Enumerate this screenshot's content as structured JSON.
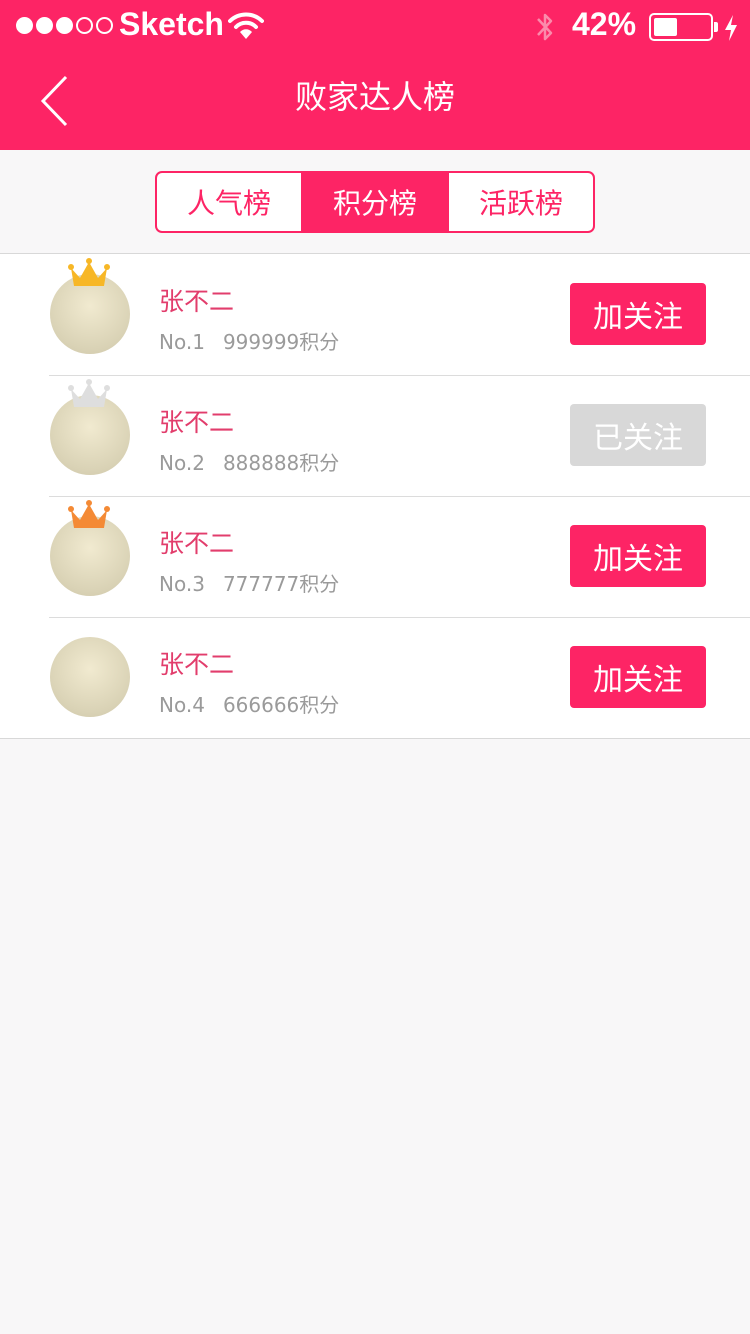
{
  "status_bar": {
    "carrier": "Sketch",
    "battery_percent_text": "42%",
    "battery_level": 0.42
  },
  "nav": {
    "title": "败家达人榜"
  },
  "tabs": [
    {
      "label": "人气榜",
      "active": false
    },
    {
      "label": "积分榜",
      "active": true
    },
    {
      "label": "活跃榜",
      "active": false
    }
  ],
  "rankings": [
    {
      "name": "张不二",
      "rank": "No.1",
      "points": "999999积分",
      "button": "加关注",
      "followed": false,
      "crown_color": "#f7b726"
    },
    {
      "name": "张不二",
      "rank": "No.2",
      "points": "888888积分",
      "button": "已关注",
      "followed": true,
      "crown_color": "#dedede"
    },
    {
      "name": "张不二",
      "rank": "No.3",
      "points": "777777积分",
      "button": "加关注",
      "followed": false,
      "crown_color": "#f48a35"
    },
    {
      "name": "张不二",
      "rank": "No.4",
      "points": "666666积分",
      "button": "加关注",
      "followed": false,
      "crown_color": ""
    }
  ],
  "colors": {
    "brand": "#fd2465",
    "name_text": "#e23d6c",
    "followed_button": "#d8d8d8"
  }
}
